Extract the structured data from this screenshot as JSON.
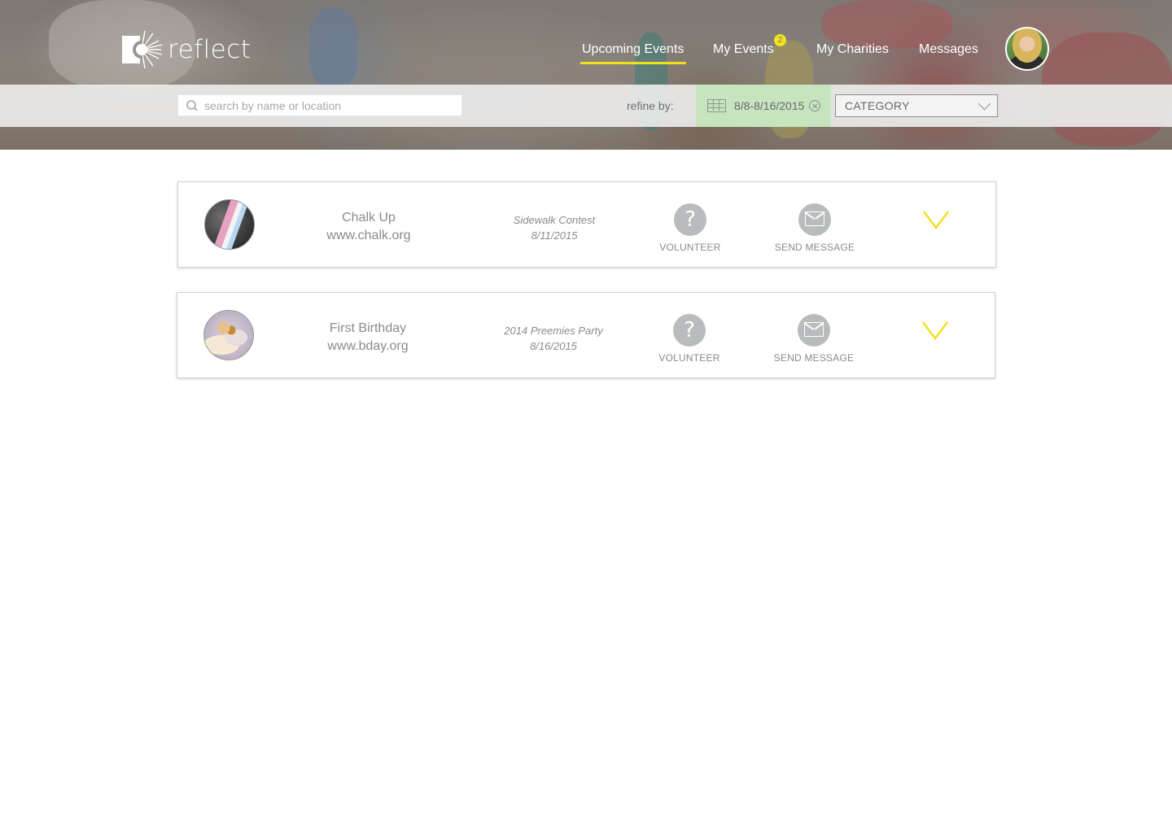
{
  "brand": {
    "name": "reflect"
  },
  "nav": {
    "items": [
      {
        "label": "Upcoming Events",
        "active": true
      },
      {
        "label": "My Events",
        "badge": "2"
      },
      {
        "label": "My Charities"
      },
      {
        "label": "Messages"
      }
    ]
  },
  "filters": {
    "search_placeholder": "search by name or location",
    "refine_label": "refine by:",
    "date_range": "8/8-8/16/2015",
    "category": "CATEGORY"
  },
  "events": [
    {
      "org_name": "Chalk Up",
      "org_url": "www.chalk.org",
      "event_name": "Sidewalk Contest",
      "event_date": "8/11/2015",
      "volunteer_label": "VOLUNTEER",
      "message_label": "SEND MESSAGE"
    },
    {
      "org_name": "First Birthday",
      "org_url": "www.bday.org",
      "event_name": "2014 Preemies Party",
      "event_date": "8/16/2015",
      "volunteer_label": "VOLUNTEER",
      "message_label": "SEND MESSAGE"
    }
  ],
  "icons": {
    "volunteer": "question-mark-icon",
    "message": "envelope-icon",
    "expand": "chevron-down-icon",
    "calendar": "calendar-icon",
    "clear": "clear-circle-icon",
    "search": "search-icon"
  },
  "colors": {
    "accent": "#f0e11c",
    "date_chip": "#c4e5bd",
    "icon_circle": "#b9bcbd",
    "text_muted": "#8b8b8b"
  }
}
